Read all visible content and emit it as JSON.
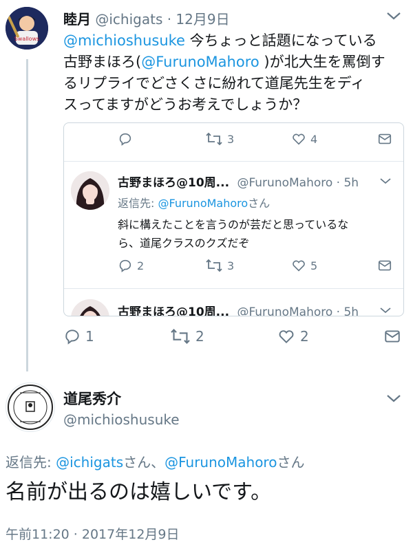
{
  "tweet1": {
    "name": "睦月",
    "handle": "@ichigats",
    "date": "· 12月9日",
    "mention": "@michioshusuke",
    "text_a": " 今ちょっと話題になっている",
    "text_b": "古野まほろ(",
    "mention2": "@FurunoMahoro",
    "text_c": " )が北大生を罵倒す",
    "text_d": "るリプライでどさくさに紛れて道尾先生をディ",
    "text_e": "スってますがどうお考えでしょうか？",
    "reply_count": "1",
    "retweet_count": "2",
    "like_count": "2"
  },
  "quoted": {
    "top_retweet_count": "3",
    "top_like_count": "4",
    "name": "古野まほろ@10周...",
    "handle": "@FurunoMahoro · 5h",
    "reply_label": "返信先: ",
    "reply_to": "@FurunoMahoro",
    "reply_suffix": "さん",
    "text_a": "斜に構えたことを言うのが芸だと思っているな",
    "text_b": "ら、道尾クラスのクズだぞ",
    "reply_count": "2",
    "retweet_count": "3",
    "like_count": "5",
    "partial_name": "古野まほろ@10周...",
    "partial_handle": "@FurunoMahoro · 5h"
  },
  "main": {
    "name": "道尾秀介",
    "handle": "@michioshusuke",
    "reply_label": "返信先: ",
    "reply_to_1": "@ichigats",
    "reply_mid": "さん、",
    "reply_to_2": "@FurunoMahoro",
    "reply_suffix": "さん",
    "text": "名前が出るのは嬉しいです。",
    "timestamp": "午前11:20 · 2017年12月9日"
  },
  "colors": {
    "accent": "#1b95e0",
    "gray": "#657786",
    "border": "#ccd6dd"
  }
}
